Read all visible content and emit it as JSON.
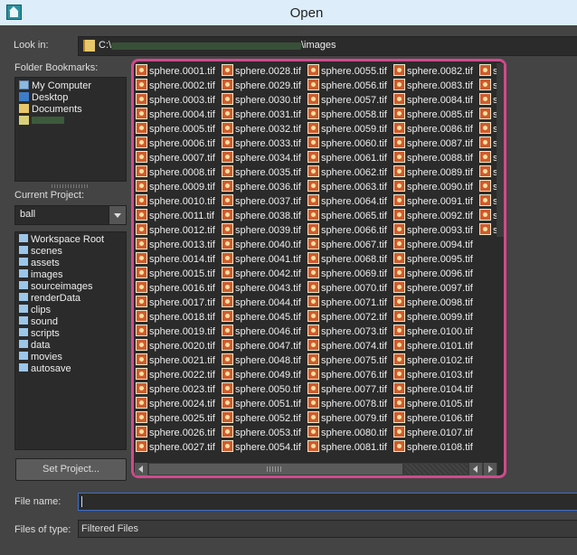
{
  "window": {
    "title": "Open"
  },
  "lookin": {
    "label": "Look in:",
    "path_prefix": "C:\\",
    "path_suffix": "\\images"
  },
  "bookmarks": {
    "label": "Folder Bookmarks:",
    "items": [
      "My Computer",
      "Desktop",
      "Documents"
    ]
  },
  "project": {
    "label": "Current Project:",
    "value": "ball",
    "folders": [
      "Workspace Root",
      "scenes",
      "assets",
      "images",
      "sourceimages",
      "renderData",
      "clips",
      "sound",
      "scripts",
      "data",
      "movies",
      "autosave"
    ],
    "set_button": "Set Project..."
  },
  "files": {
    "col1": [
      "sphere.0001.tif",
      "sphere.0002.tif",
      "sphere.0003.tif",
      "sphere.0004.tif",
      "sphere.0005.tif",
      "sphere.0006.tif",
      "sphere.0007.tif",
      "sphere.0008.tif",
      "sphere.0009.tif",
      "sphere.0010.tif",
      "sphere.0011.tif",
      "sphere.0012.tif",
      "sphere.0013.tif",
      "sphere.0014.tif",
      "sphere.0015.tif",
      "sphere.0016.tif",
      "sphere.0017.tif",
      "sphere.0018.tif",
      "sphere.0019.tif",
      "sphere.0020.tif",
      "sphere.0021.tif",
      "sphere.0022.tif",
      "sphere.0023.tif",
      "sphere.0024.tif",
      "sphere.0025.tif",
      "sphere.0026.tif",
      "sphere.0027.tif"
    ],
    "col2": [
      "sphere.0028.tif",
      "sphere.0029.tif",
      "sphere.0030.tif",
      "sphere.0031.tif",
      "sphere.0032.tif",
      "sphere.0033.tif",
      "sphere.0034.tif",
      "sphere.0035.tif",
      "sphere.0036.tif",
      "sphere.0037.tif",
      "sphere.0038.tif",
      "sphere.0039.tif",
      "sphere.0040.tif",
      "sphere.0041.tif",
      "sphere.0042.tif",
      "sphere.0043.tif",
      "sphere.0044.tif",
      "sphere.0045.tif",
      "sphere.0046.tif",
      "sphere.0047.tif",
      "sphere.0048.tif",
      "sphere.0049.tif",
      "sphere.0050.tif",
      "sphere.0051.tif",
      "sphere.0052.tif",
      "sphere.0053.tif",
      "sphere.0054.tif"
    ],
    "col3": [
      "sphere.0055.tif",
      "sphere.0056.tif",
      "sphere.0057.tif",
      "sphere.0058.tif",
      "sphere.0059.tif",
      "sphere.0060.tif",
      "sphere.0061.tif",
      "sphere.0062.tif",
      "sphere.0063.tif",
      "sphere.0064.tif",
      "sphere.0065.tif",
      "sphere.0066.tif",
      "sphere.0067.tif",
      "sphere.0068.tif",
      "sphere.0069.tif",
      "sphere.0070.tif",
      "sphere.0071.tif",
      "sphere.0072.tif",
      "sphere.0073.tif",
      "sphere.0074.tif",
      "sphere.0075.tif",
      "sphere.0076.tif",
      "sphere.0077.tif",
      "sphere.0078.tif",
      "sphere.0079.tif",
      "sphere.0080.tif",
      "sphere.0081.tif"
    ],
    "col4": [
      "sphere.0082.tif",
      "sphere.0083.tif",
      "sphere.0084.tif",
      "sphere.0085.tif",
      "sphere.0086.tif",
      "sphere.0087.tif",
      "sphere.0088.tif",
      "sphere.0089.tif",
      "sphere.0090.tif",
      "sphere.0091.tif",
      "sphere.0092.tif",
      "sphere.0093.tif",
      "sphere.0094.tif",
      "sphere.0095.tif",
      "sphere.0096.tif",
      "sphere.0097.tif",
      "sphere.0098.tif",
      "sphere.0099.tif",
      "sphere.0100.tif",
      "sphere.0101.tif",
      "sphere.0102.tif",
      "sphere.0103.tif",
      "sphere.0104.tif",
      "sphere.0105.tif",
      "sphere.0106.tif",
      "sphere.0107.tif",
      "sphere.0108.tif"
    ],
    "col5": [
      "s",
      "s",
      "s",
      "s",
      "s",
      "s",
      "s",
      "s",
      "s",
      "s",
      "s",
      "s"
    ],
    "highlight_color": "#d04a8d"
  },
  "filename": {
    "label": "File name:",
    "value": ""
  },
  "filetype": {
    "label": "Files of type:",
    "value": "Filtered Files"
  }
}
